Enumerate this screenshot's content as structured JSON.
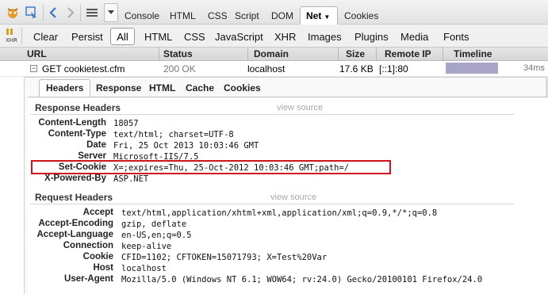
{
  "toolbar": {
    "tabs": [
      "Console",
      "HTML",
      "CSS",
      "Script",
      "DOM"
    ],
    "active_tab": "Net",
    "extra_tab": "Cookies"
  },
  "filters": {
    "clear": "Clear",
    "persist": "Persist",
    "items": [
      "All",
      "HTML",
      "CSS",
      "JavaScript",
      "XHR",
      "Images",
      "Plugins",
      "Media",
      "Fonts"
    ]
  },
  "net_columns": [
    "URL",
    "Status",
    "Domain",
    "Size",
    "Remote IP",
    "Timeline"
  ],
  "request": {
    "toggle": "⊟",
    "url": "GET cookietest.cfm",
    "status": "200 OK",
    "domain": "localhost",
    "size": "17.6 KB",
    "remote_ip": "[::1]:80",
    "time": "34ms"
  },
  "detail_tabs": [
    "Headers",
    "Response",
    "HTML",
    "Cache",
    "Cookies"
  ],
  "response_headers": {
    "title": "Response Headers",
    "view_source": "view source",
    "rows": [
      {
        "name": "Content-Length",
        "value": "18057"
      },
      {
        "name": "Content-Type",
        "value": "text/html; charset=UTF-8"
      },
      {
        "name": "Date",
        "value": "Fri, 25 Oct 2013 10:03:46 GMT"
      },
      {
        "name": "Server",
        "value": "Microsoft-IIS/7.5"
      },
      {
        "name": "Set-Cookie",
        "value": "X=;expires=Thu, 25-Oct-2012 10:03:46 GMT;path=/"
      },
      {
        "name": "X-Powered-By",
        "value": "ASP.NET"
      }
    ]
  },
  "request_headers": {
    "title": "Request Headers",
    "view_source": "view source",
    "rows": [
      {
        "name": "Accept",
        "value": "text/html,application/xhtml+xml,application/xml;q=0.9,*/*;q=0.8"
      },
      {
        "name": "Accept-Encoding",
        "value": "gzip, deflate"
      },
      {
        "name": "Accept-Language",
        "value": "en-US,en;q=0.5"
      },
      {
        "name": "Connection",
        "value": "keep-alive"
      },
      {
        "name": "Cookie",
        "value": "CFID=1102; CFTOKEN=15071793; X=Test%20Var"
      },
      {
        "name": "Host",
        "value": "localhost"
      },
      {
        "name": "User-Agent",
        "value": "Mozilla/5.0 (Windows NT 6.1; WOW64; rv:24.0) Gecko/20100101 Firefox/24.0"
      }
    ]
  },
  "highlight_color": "#d0121e",
  "timeline_color": "#a8a4c8"
}
